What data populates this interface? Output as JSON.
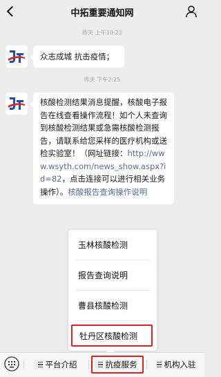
{
  "header": {
    "title": "中拓重要通知网"
  },
  "messages": [
    {
      "timestamp": "昨天 上午10:23",
      "text": "众志成城  抗击疫情；"
    },
    {
      "timestamp": "昨天 下午2:25",
      "text_before_link": "核酸检测结果消息提醒，核酸电子报告在线查看操作流程！如个人未查询到核酸检测结果或急需核酸检测报告，请联系给您采样的医疗机构或送检实验室！（网址链接：",
      "link": "http://www.wsyth.com/news_show.aspx?id=82",
      "text_after_link": "，点击连接可以进行相关业务操作）。",
      "link2": "核酸报告查询操作说明"
    }
  ],
  "popup_menu": {
    "items": [
      "玉林核酸检测",
      "报告查询说明",
      "曹县核酸检测",
      "牡丹区核酸检测"
    ]
  },
  "bottom_menu": {
    "items": [
      "平台介绍",
      "抗疫服务",
      "机构入驻"
    ]
  },
  "colors": {
    "highlight": "#e02020",
    "link": "#576b95"
  }
}
